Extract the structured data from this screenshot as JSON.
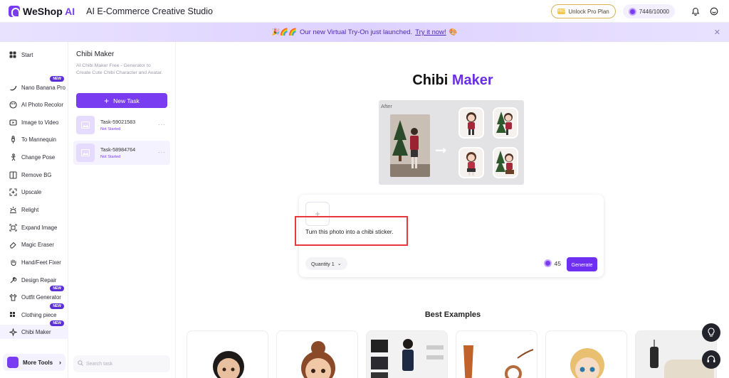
{
  "brand": {
    "name_main": "WeShop",
    "name_accent": " AI",
    "app_title": "AI E-Commerce Creative Studio"
  },
  "topbar": {
    "pro_label": "Unlock Pro Plan",
    "pro_icon": "PRO",
    "credits": "7446/10000"
  },
  "banner": {
    "emoji": "🎉🌈🌈",
    "text": "Our new Virtual Try-On just launched.",
    "link": "Try it now!",
    "close": "✕",
    "colors": {
      "bg": "#e6defe",
      "text": "#4b2ab5"
    }
  },
  "sidebar": {
    "items": [
      {
        "label": "Start",
        "icon": "grid-icon",
        "new": false
      },
      {
        "label": "Nano Banana Pro",
        "icon": "banana-icon",
        "new": true
      },
      {
        "label": "AI Photo Recolor",
        "icon": "palette-icon",
        "new": false
      },
      {
        "label": "Image to Video",
        "icon": "video-icon",
        "new": false
      },
      {
        "label": "To Mannequin",
        "icon": "mannequin-icon",
        "new": false
      },
      {
        "label": "Change Pose",
        "icon": "pose-icon",
        "new": false
      },
      {
        "label": "Remove BG",
        "icon": "remove-bg-icon",
        "new": false
      },
      {
        "label": "Upscale",
        "icon": "upscale-icon",
        "new": false
      },
      {
        "label": "Relight",
        "icon": "relight-icon",
        "new": false
      },
      {
        "label": "Expand Image",
        "icon": "expand-icon",
        "new": false
      },
      {
        "label": "Magic Eraser",
        "icon": "eraser-icon",
        "new": false
      },
      {
        "label": "Hand/Feet Fixer",
        "icon": "hand-icon",
        "new": false
      },
      {
        "label": "Design Repair",
        "icon": "repair-icon",
        "new": false
      },
      {
        "label": "Outfit Generator",
        "icon": "outfit-icon",
        "new": true
      },
      {
        "label": "Clothing piece",
        "icon": "clothing-icon",
        "new": true
      },
      {
        "label": "Chibi Maker",
        "icon": "sparkle-icon",
        "new": true
      }
    ],
    "badge_label": "NEW",
    "more_tools": "More Tools"
  },
  "tasks_panel": {
    "title": "Chibi Maker",
    "description": "AI Chibi Maker Free - Generator to Create Cute Chibi Character and Avatar.",
    "new_task": "New Task",
    "tasks": [
      {
        "name": "Task-59021583",
        "status": "Not Started"
      },
      {
        "name": "Task-58984764",
        "status": "Not Started"
      }
    ],
    "search_placeholder": "Search task"
  },
  "main": {
    "title_plain": "Chibi ",
    "title_accent": "Maker",
    "preview_label": "After",
    "prompt": "Turn this photo into a chibi sticker.",
    "quantity": "Quantity 1",
    "cost": "45",
    "generate": "Generate",
    "best_examples": "Best Examples"
  },
  "colors": {
    "accent": "#7a3cf0",
    "highlight": "#e8383d"
  }
}
